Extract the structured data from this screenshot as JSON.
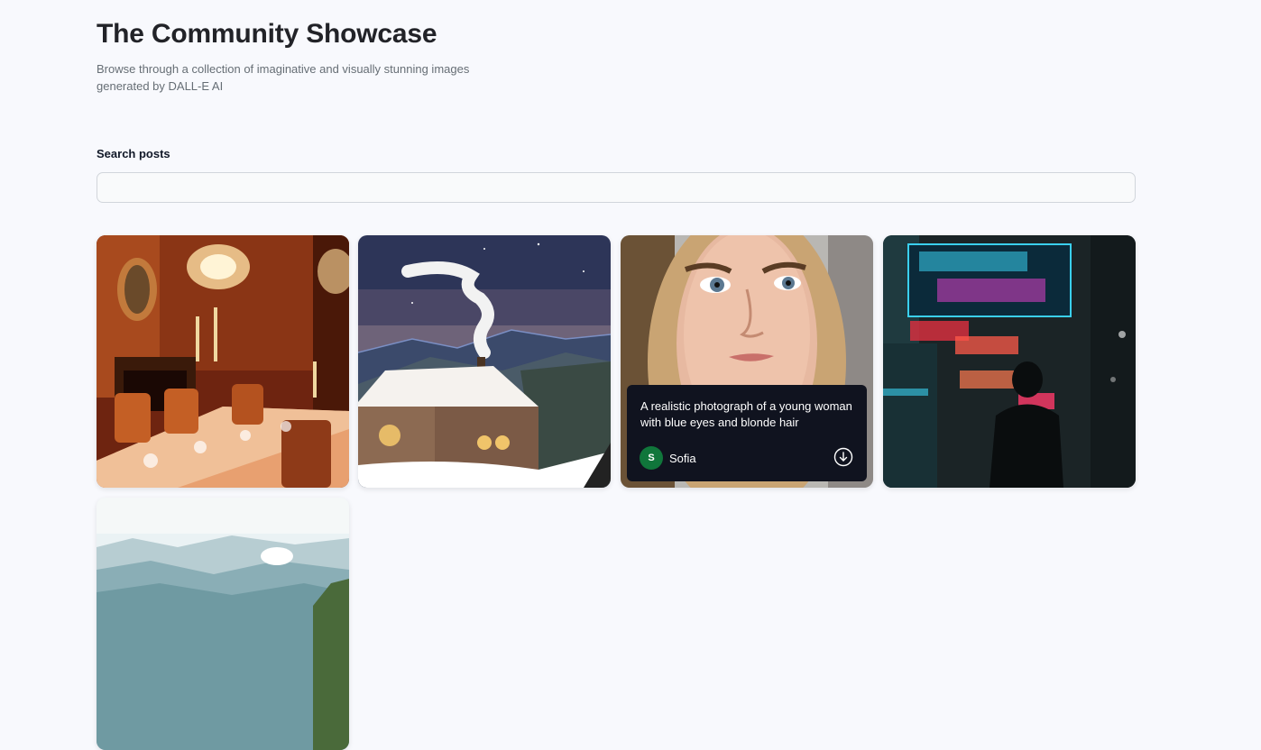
{
  "header": {
    "title": "The Community Showcase",
    "subtitle": "Browse through a collection of imaginative and visually stunning images generated by DALL-E AI"
  },
  "search": {
    "label": "Search posts",
    "value": "",
    "placeholder": ""
  },
  "posts": [
    {
      "image": "candlelit-dining-room",
      "prompt": "",
      "author": ""
    },
    {
      "image": "snowy-cabin-illustration",
      "prompt": "",
      "author": ""
    },
    {
      "image": "young-woman-portrait",
      "prompt": "A realistic photograph of a young woman with blue eyes and blonde hair",
      "author": "Sofia",
      "avatar_initial": "S",
      "avatar_color": "#10763b",
      "download_icon": "download-icon"
    },
    {
      "image": "neon-city-street",
      "prompt": "",
      "author": ""
    },
    {
      "image": "misty-mountain-landscape",
      "prompt": "",
      "author": ""
    }
  ]
}
